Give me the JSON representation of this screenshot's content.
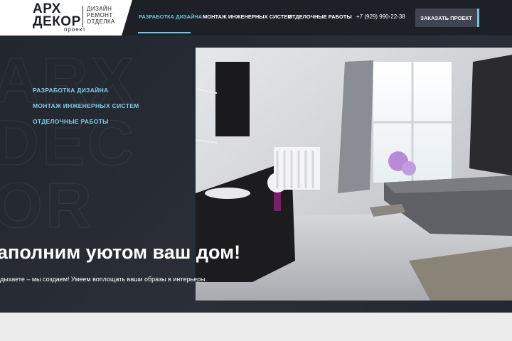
{
  "logo": {
    "line1": "АРХ",
    "line2": "ДЕКОР",
    "sub": "проект",
    "tag1": "ДИЗАЙН",
    "tag2": "РЕМОНТ",
    "tag3": "ОТДЕЛКА"
  },
  "nav": {
    "items": [
      {
        "label": "РАЗРАБОТКА ДИЗАЙНА",
        "active": true
      },
      {
        "label": "МОНТАЖ ИНЖЕНЕРНЫХ СИСТЕМ",
        "active": false
      },
      {
        "label": "ОТДЕЛОЧНЫЕ РАБОТЫ",
        "active": false
      }
    ],
    "phone": "+7 (929) 990-22-38",
    "cta": "ЗАКАЗАТЬ ПРОЕКТ"
  },
  "hero": {
    "side_links": [
      "РАЗРАБОТКА ДИЗАЙНА",
      "МОНТАЖ ИНЖЕНЕРНЫХ СИСТЕМ",
      "ОТДЕЛОЧНЫЕ РАБОТЫ"
    ],
    "headline": "аполним уютом ваш дом!",
    "subline": "дыхаете – мы создаем! Умеем воплощать ваши образы в интерьеры."
  },
  "colors": {
    "accent": "#6ec6d8",
    "header_bg": "#1d2027",
    "hero_bg": "#262a32"
  }
}
